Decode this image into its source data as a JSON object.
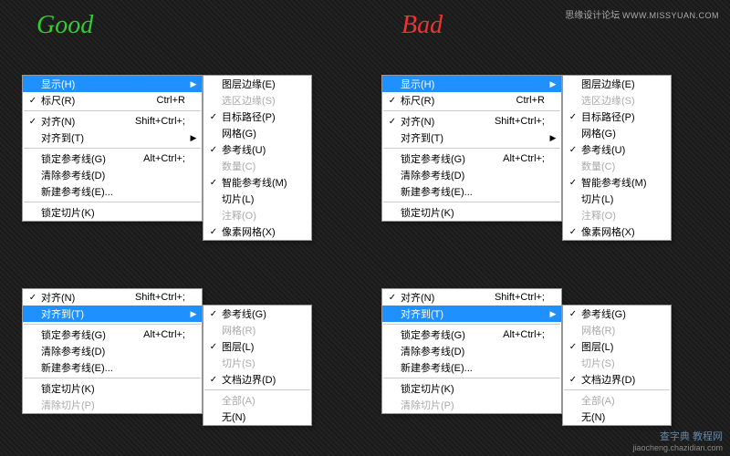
{
  "labels": {
    "good": "Good",
    "bad": "Bad"
  },
  "credits": {
    "top_text": "思缘设计论坛",
    "top_url": "WWW.MISSYUAN.COM",
    "bot_main": "查字典 教程网",
    "bot_sub": "jiaocheng.chazidian.com"
  },
  "main_menu": {
    "items": [
      {
        "label": "显示(H)",
        "shortcut": "",
        "checked": false,
        "submenu": true,
        "highlight": true
      },
      {
        "label": "标尺(R)",
        "shortcut": "Ctrl+R",
        "checked": true,
        "submenu": false
      },
      {
        "sep": true
      },
      {
        "label": "对齐(N)",
        "shortcut": "Shift+Ctrl+;",
        "checked": true,
        "submenu": false
      },
      {
        "label": "对齐到(T)",
        "shortcut": "",
        "checked": false,
        "submenu": true
      },
      {
        "sep": true
      },
      {
        "label": "锁定参考线(G)",
        "shortcut": "Alt+Ctrl+;",
        "checked": false,
        "submenu": false
      },
      {
        "label": "清除参考线(D)",
        "shortcut": "",
        "checked": false,
        "submenu": false
      },
      {
        "label": "新建参考线(E)...",
        "shortcut": "",
        "checked": false,
        "submenu": false
      },
      {
        "sep": true
      },
      {
        "label": "锁定切片(K)",
        "shortcut": "",
        "checked": false,
        "submenu": false
      }
    ]
  },
  "show_submenu": {
    "items": [
      {
        "label": "图层边缘(E)",
        "checked": false
      },
      {
        "label": "选区边缘(S)",
        "checked": false,
        "disabled": true
      },
      {
        "label": "目标路径(P)",
        "checked": true
      },
      {
        "label": "网格(G)",
        "checked": false
      },
      {
        "label": "参考线(U)",
        "checked": true
      },
      {
        "label": "数量(C)",
        "checked": false,
        "disabled": true
      },
      {
        "label": "智能参考线(M)",
        "checked": true
      },
      {
        "label": "切片(L)",
        "checked": false
      },
      {
        "label": "注释(O)",
        "checked": false,
        "disabled": true
      },
      {
        "label": "像素网格(X)",
        "checked": true
      }
    ]
  },
  "bottom_menu": {
    "items": [
      {
        "label": "对齐(N)",
        "shortcut": "Shift+Ctrl+;",
        "checked": true,
        "submenu": false
      },
      {
        "label": "对齐到(T)",
        "shortcut": "",
        "checked": false,
        "submenu": true,
        "highlight": true
      },
      {
        "sep": true
      },
      {
        "label": "锁定参考线(G)",
        "shortcut": "Alt+Ctrl+;",
        "checked": false,
        "submenu": false
      },
      {
        "label": "清除参考线(D)",
        "shortcut": "",
        "checked": false,
        "submenu": false
      },
      {
        "label": "新建参考线(E)...",
        "shortcut": "",
        "checked": false,
        "submenu": false
      },
      {
        "sep": true
      },
      {
        "label": "锁定切片(K)",
        "shortcut": "",
        "checked": false,
        "submenu": false
      },
      {
        "label": "清除切片(P)",
        "shortcut": "",
        "checked": false,
        "submenu": false,
        "disabled": true
      }
    ]
  },
  "snap_submenu": {
    "items": [
      {
        "label": "参考线(G)",
        "checked": true
      },
      {
        "label": "网格(R)",
        "checked": false,
        "disabled": true
      },
      {
        "label": "图层(L)",
        "checked": true
      },
      {
        "label": "切片(S)",
        "checked": false,
        "disabled": true
      },
      {
        "label": "文档边界(D)",
        "checked": true
      },
      {
        "sep": true
      },
      {
        "label": "全部(A)",
        "checked": false,
        "disabled": true
      },
      {
        "label": "无(N)",
        "checked": false
      }
    ]
  }
}
